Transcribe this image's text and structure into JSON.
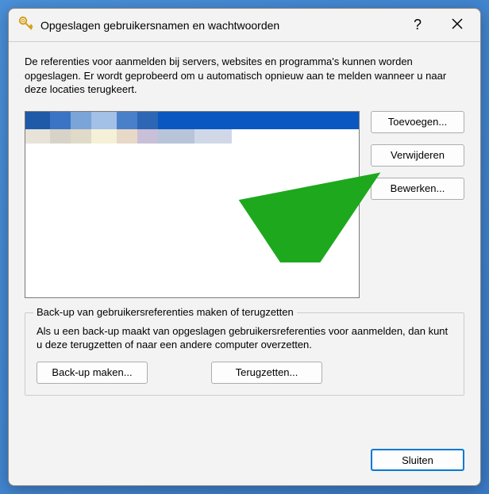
{
  "titlebar": {
    "title": "Opgeslagen gebruikersnamen en wachtwoorden",
    "help_symbol": "?",
    "close_symbol": "✕"
  },
  "description": "De referenties voor aanmelden bij servers, websites en programma's kunnen worden opgeslagen. Er wordt geprobeerd om u automatisch opnieuw aan te melden wanneer u naar deze locaties terugkeert.",
  "buttons": {
    "add": "Toevoegen...",
    "remove": "Verwijderen",
    "edit": "Bewerken...",
    "backup": "Back-up maken...",
    "restore": "Terugzetten...",
    "close": "Sluiten"
  },
  "groupbox": {
    "title": "Back-up van gebruikersreferenties maken of terugzetten",
    "text": "Als u een back-up maakt van opgeslagen gebruikersreferenties voor aanmelden, dan kunt u deze terugzetten of naar een andere computer overzetten."
  }
}
